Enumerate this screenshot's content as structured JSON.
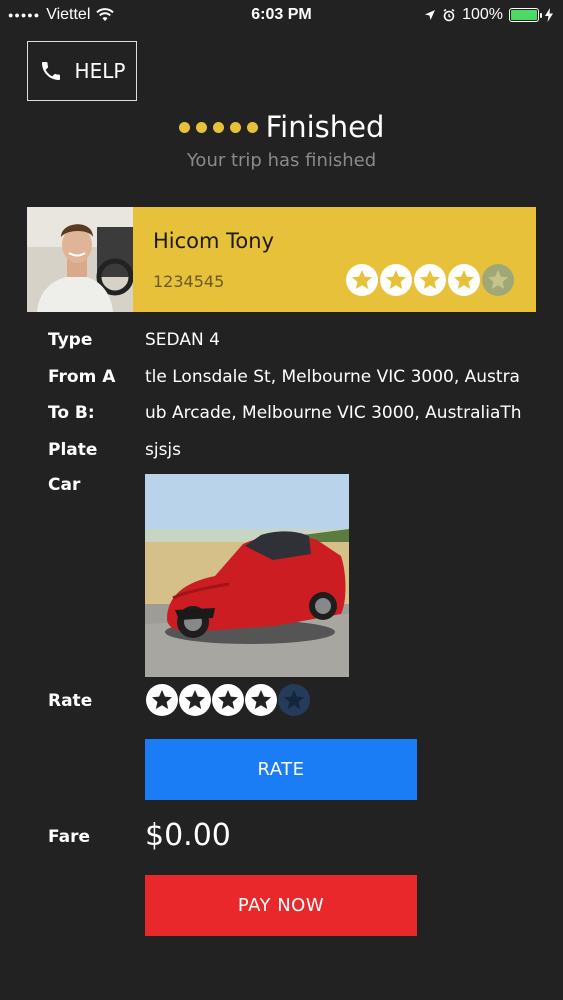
{
  "status_bar": {
    "carrier": "Viettel",
    "time": "6:03 PM",
    "battery": "100%"
  },
  "help": {
    "label": "HELP"
  },
  "trip": {
    "status": "Finished",
    "subtitle": "Your trip has finished"
  },
  "driver": {
    "name": "Hicom Tony",
    "id": "1234545",
    "rating": 4,
    "max_rating": 5
  },
  "details": {
    "type_label": "Type",
    "type_value": "SEDAN 4",
    "from_label": "From A",
    "from_value": "tle Lonsdale St, Melbourne VIC 3000, Austra",
    "to_label": "To B:",
    "to_value": "ub Arcade, Melbourne VIC 3000, AustraliaTh",
    "plate_label": "Plate",
    "plate_value": "sjsjs",
    "car_label": "Car",
    "rate_label": "Rate",
    "fare_label": "Fare",
    "fare_value": "$0.00"
  },
  "rate": {
    "value": 4,
    "max": 5,
    "button_label": "RATE"
  },
  "pay": {
    "button_label": "PAY NOW"
  },
  "colors": {
    "background": "#222222",
    "accent_yellow": "#e8c13a",
    "rate_button": "#1a7df5",
    "pay_button": "#e8282b"
  }
}
